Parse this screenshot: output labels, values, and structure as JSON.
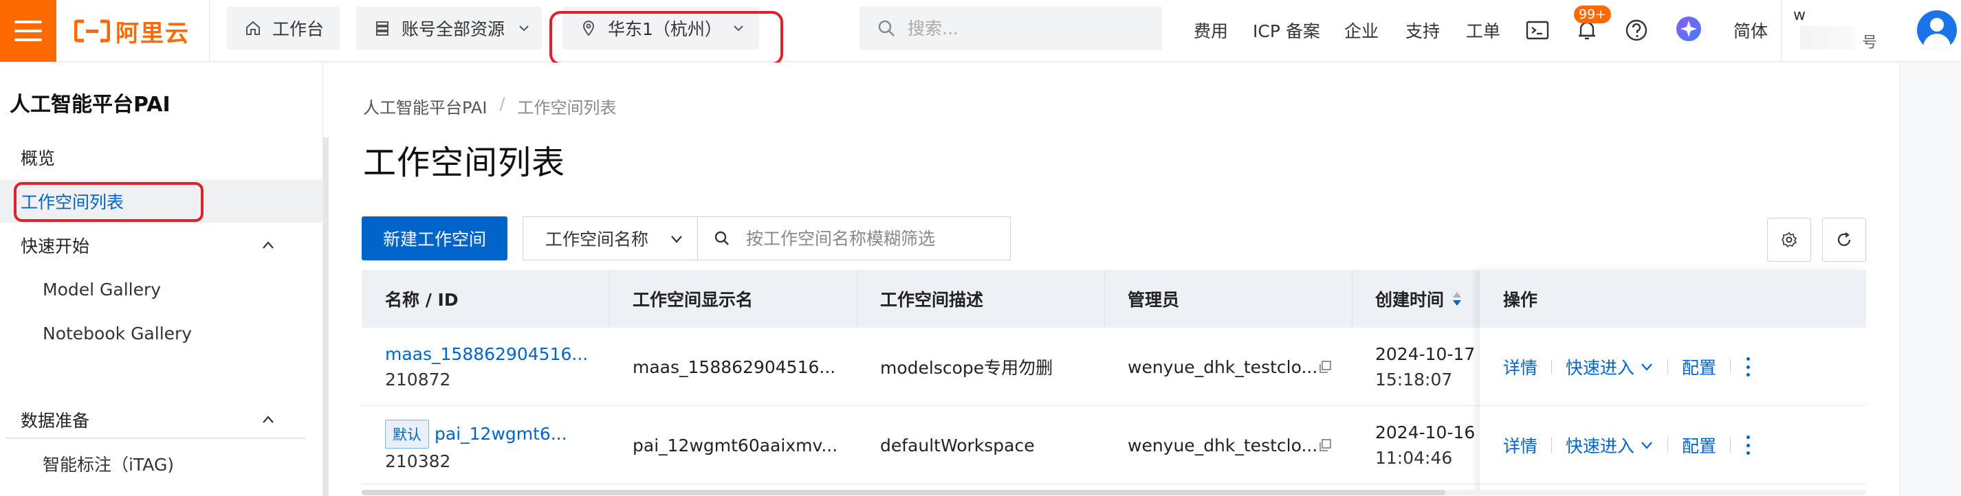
{
  "topbar": {
    "logo_text": "阿里云",
    "workbench_label": "工作台",
    "resource_label": "账号全部资源",
    "region_label": "华东1（杭州）",
    "search_placeholder": "搜索...",
    "links": [
      "费用",
      "ICP 备案",
      "企业",
      "支持",
      "工单"
    ],
    "notification_badge": "99+",
    "lang_label": "简体",
    "user_name": "w",
    "user_sub": "号",
    "brand_color": "#ff6a00",
    "accent_color": "#0064c8"
  },
  "sidebar": {
    "title": "人工智能平台PAI",
    "items": [
      {
        "label": "概览"
      },
      {
        "label": "工作空间列表"
      },
      {
        "label": "快速开始"
      },
      {
        "label": "Model Gallery"
      },
      {
        "label": "Notebook Gallery"
      },
      {
        "label": "数据准备"
      },
      {
        "label": "智能标注（iTAG)"
      }
    ]
  },
  "main": {
    "breadcrumb": [
      "人工智能平台PAI",
      "工作空间列表"
    ],
    "breadcrumb_sep": "/",
    "title": "工作空间列表",
    "new_button": "新建工作空间",
    "filter_field": "工作空间名称",
    "filter_placeholder": "按工作空间名称模糊筛选",
    "columns": [
      "名称 / ID",
      "工作空间显示名",
      "工作空间描述",
      "管理员",
      "创建时间",
      "操作"
    ],
    "rows": [
      {
        "name": "maas_158862904516...",
        "id": "210872",
        "tag": "",
        "display_name": "maas_158862904516...",
        "description": "modelscope专用勿删",
        "admin": "wenyue_dhk_testclo...",
        "created_date": "2024-10-17",
        "created_time": "15:18:07"
      },
      {
        "name": "pai_12wgmt6...",
        "id": "210382",
        "tag": "默认",
        "display_name": "pai_12wgmt60aaixmv...",
        "description": "defaultWorkspace",
        "admin": "wenyue_dhk_testclo...",
        "created_date": "2024-10-16",
        "created_time": "11:04:46"
      }
    ],
    "actions": {
      "detail": "详情",
      "quick_enter": "快速进入",
      "config": "配置"
    }
  }
}
